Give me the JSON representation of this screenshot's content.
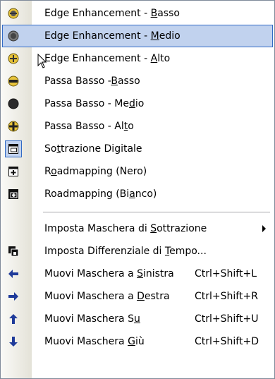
{
  "menu": {
    "items": [
      {
        "pre": "Edge Enhancement - ",
        "ul": "B",
        "post": "asso",
        "icon": "dot-sphere-dark-icon"
      },
      {
        "pre": "Edge Enhancement - ",
        "ul": "M",
        "post": "edio",
        "icon": "dot-sphere-darker-icon",
        "highlighted": true
      },
      {
        "pre": "Edge Enhancement - ",
        "ul": "A",
        "post": "lto",
        "icon": "plus-sphere-icon"
      },
      {
        "pre": "Passa Basso -",
        "ul": "B",
        "post": "asso",
        "icon": "minus-sphere-icon"
      },
      {
        "pre": "Passa Basso - Me",
        "ul": "d",
        "post": "io",
        "icon": "solid-sphere-icon"
      },
      {
        "pre": "Passa Basso - Al",
        "ul": "t",
        "post": "o",
        "icon": "plus-sphere-icon"
      },
      {
        "pre": "So",
        "ul": "t",
        "post": "trazione Digitale",
        "icon": "subtraction-window-icon"
      },
      {
        "pre": "R",
        "ul": "o",
        "post": "admapping (Nero)",
        "icon": "roadmap-black-icon"
      },
      {
        "pre": "Roadmapping (Bi",
        "ul": "a",
        "post": "nco)",
        "icon": "roadmap-white-icon"
      },
      {
        "pre": "Imposta Maschera di ",
        "ul": "S",
        "post": "ottrazione",
        "submenu": true
      },
      {
        "pre": "Imposta Differenziale di ",
        "ul": "T",
        "post": "empo...",
        "icon": "stacked-windows-icon"
      },
      {
        "pre": "Muovi Maschera a ",
        "ul": "S",
        "post": "inistra",
        "shortcut": "Ctrl+Shift+L",
        "icon": "arrow-left-icon"
      },
      {
        "pre": "Muovi Maschera a ",
        "ul": "D",
        "post": "estra",
        "shortcut": "Ctrl+Shift+R",
        "icon": "arrow-right-icon"
      },
      {
        "pre": "Muovi Maschera S",
        "ul": "u",
        "post": "",
        "shortcut": "Ctrl+Shift+U",
        "icon": "arrow-up-icon"
      },
      {
        "pre": "Muovi Maschera ",
        "ul": "G",
        "post": "iù",
        "shortcut": "Ctrl+Shift+D",
        "icon": "arrow-down-icon"
      }
    ]
  },
  "colors": {
    "highlight_bg": "#c1d2ee",
    "highlight_border": "#316ac5",
    "arrow_blue": "#1f3b9a",
    "sphere_yellow": "#e8c43a"
  }
}
